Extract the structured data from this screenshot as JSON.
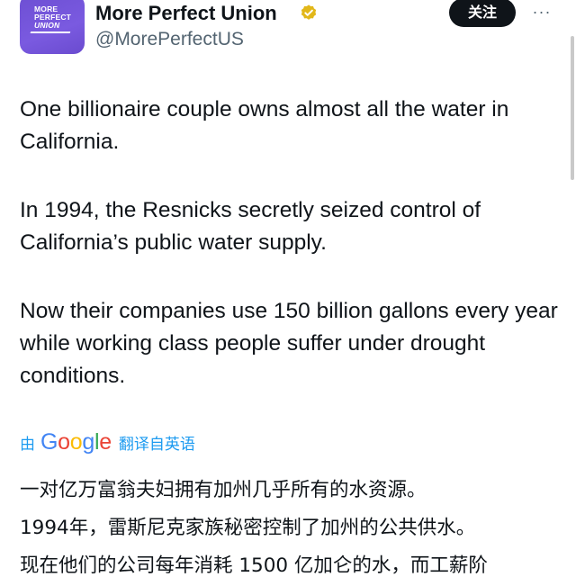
{
  "account": {
    "display_name": "More Perfect Union",
    "handle": "@MorePerfectUS",
    "verified_icon": "verified-badge-icon",
    "avatar_logo_lines": [
      "MORE",
      "PERFECT",
      "UNION"
    ],
    "avatar_color": "#7a5ae0"
  },
  "actions": {
    "follow_label": "关注",
    "more_label": "···"
  },
  "tweet": {
    "paragraphs": [
      "One billionaire couple owns almost all the water in California.",
      "In 1994, the Resnicks secretly seized control of California’s public water supply.",
      "Now their companies use 150 billion gallons every year while working class people suffer under drought conditions."
    ]
  },
  "translation": {
    "by_label": "由",
    "provider_letters": [
      "G",
      "o",
      "o",
      "g",
      "l",
      "e"
    ],
    "from_label": "翻译自英语",
    "link_color": "#1d9bf0",
    "lines": [
      "一对亿万富翁夫妇拥有加州几乎所有的水资源。",
      "1994年，雷斯尼克家族秘密控制了加州的公共供水。",
      "现在他们的公司每年消耗 1500 亿加仑的水，而工薪阶"
    ]
  },
  "colors": {
    "text": "#0f1419",
    "secondary": "#536471",
    "verified_gold": "#e2b719",
    "follow_button_bg": "#0f1419"
  }
}
